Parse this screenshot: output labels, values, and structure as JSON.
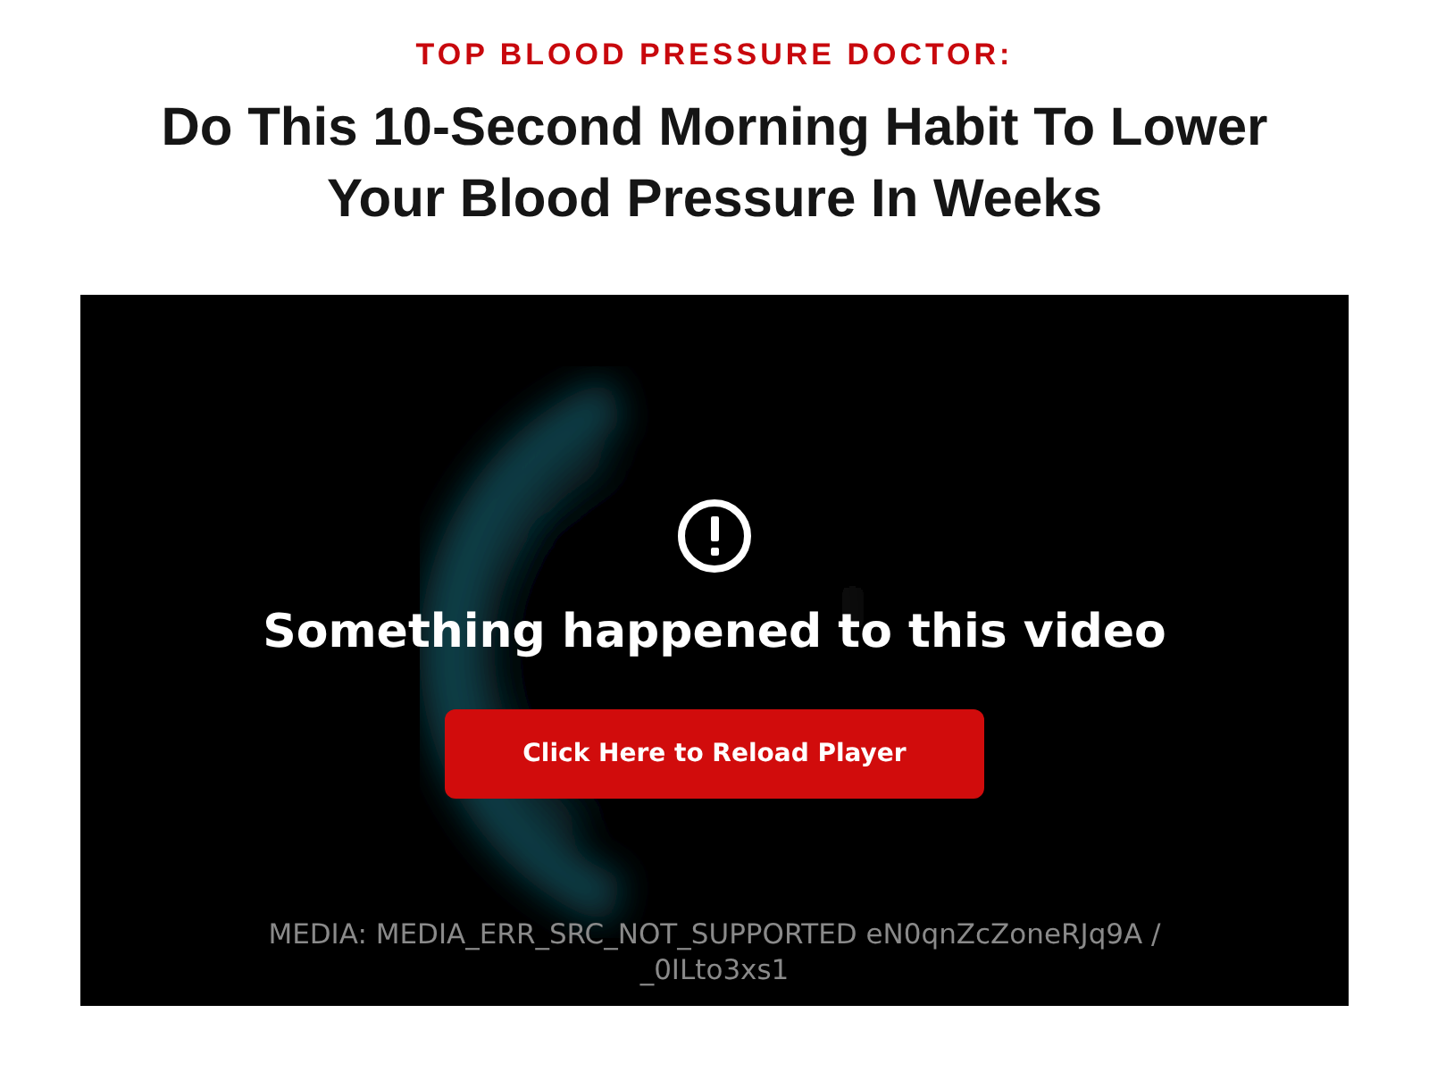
{
  "kicker": "TOP BLOOD PRESSURE DOCTOR:",
  "headline": "Do This 10-Second Morning Habit To Lower Your Blood Pressure In Weeks",
  "video": {
    "kind": "picture",
    "error": {
      "message": "Something happened to this video",
      "button": "Click Here to Reload Player",
      "details": "MEDIA: MEDIA_ERR_SRC_NOT_SUPPORTED eN0qnZcZoneRJq9A / _0ILto3xs1"
    }
  }
}
